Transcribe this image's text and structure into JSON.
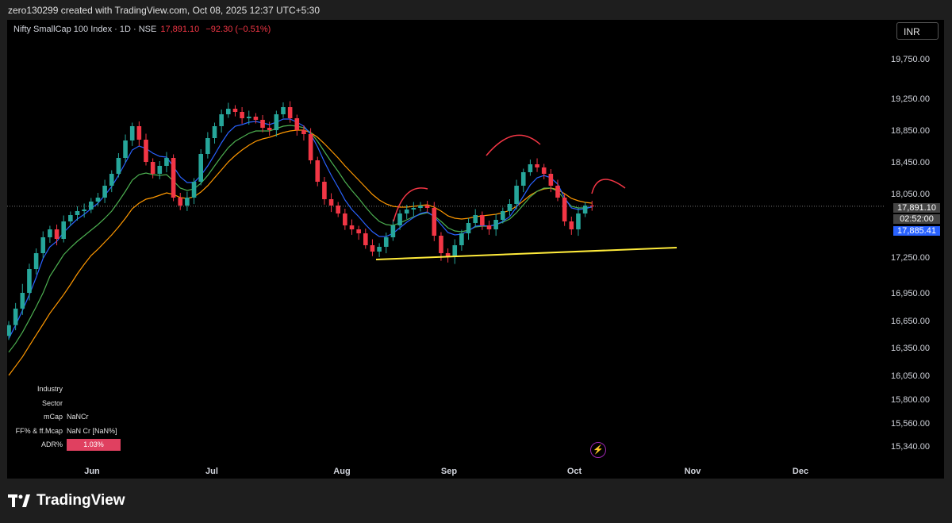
{
  "header": {
    "attribution": "zero130299 created with TradingView.com, Oct 08, 2025 12:37 UTC+5:30"
  },
  "symbol": {
    "name": "Nifty SmallCap 100 Index · 1D · NSE",
    "last": "17,891.10",
    "change": "−92.30 (−0.51%)"
  },
  "currency_button": "INR",
  "price_tags": {
    "last": "17,891.10",
    "countdown": "02:52:00",
    "ma": "17,885.41"
  },
  "info_table": {
    "industry_label": "Industry",
    "sector_label": "Sector",
    "mcap_label": "mCap",
    "mcap_value": "NaNCr",
    "ff_label": "FF% & ff.Mcap",
    "ff_value": "NaN Cr [NaN%]",
    "adr_label": "ADR%",
    "adr_value": "1.03%"
  },
  "footer": {
    "brand": "TradingView"
  },
  "icons": {
    "bolt": "lightning-icon",
    "logo": "tradingview-logo-icon"
  },
  "colors": {
    "up": "#26a69a",
    "down": "#f23645",
    "ma_fast": "#2962ff",
    "ma_mid": "#4caf50",
    "ma_slow": "#ff9800",
    "support": "#ffeb3b",
    "annotation": "#f23645"
  },
  "chart_data": {
    "type": "candlestick",
    "y_ticks": [
      "19,750.00",
      "19,250.00",
      "18,850.00",
      "18,450.00",
      "18,050.00",
      "17,250.00",
      "16,950.00",
      "16,650.00",
      "16,350.00",
      "16,050.00",
      "15,800.00",
      "15,560.00",
      "15,340.00"
    ],
    "x_ticks": [
      "Jun",
      "Jul",
      "Aug",
      "Sep",
      "Oct",
      "Nov",
      "Dec"
    ],
    "last_price": 17891.1,
    "closes": [
      16600,
      16780,
      16950,
      17150,
      17300,
      17500,
      17600,
      17480,
      17700,
      17780,
      17830,
      17850,
      17950,
      18000,
      18150,
      18300,
      18500,
      18720,
      18900,
      18730,
      18450,
      18300,
      18400,
      18500,
      18000,
      17900,
      18000,
      18200,
      18550,
      18750,
      18900,
      19050,
      19120,
      19080,
      19000,
      19020,
      18980,
      18880,
      18850,
      19050,
      19140,
      19000,
      18850,
      18800,
      18470,
      18200,
      17980,
      17900,
      17800,
      17650,
      17600,
      17550,
      17400,
      17320,
      17380,
      17500,
      17650,
      17800,
      17850,
      17870,
      17900,
      17870,
      17520,
      17300,
      17250,
      17400,
      17550,
      17680,
      17780,
      17650,
      17600,
      17720,
      17830,
      17920,
      18150,
      18320,
      18420,
      18380,
      18300,
      18150,
      18000,
      17700,
      17600,
      17800,
      17900,
      17891.1
    ],
    "ma_fast": [
      16450,
      16600,
      16760,
      16930,
      17080,
      17240,
      17380,
      17450,
      17560,
      17650,
      17730,
      17790,
      17860,
      17930,
      18030,
      18140,
      18280,
      18440,
      18600,
      18650,
      18620,
      18560,
      18520,
      18510,
      18390,
      18260,
      18190,
      18190,
      18280,
      18400,
      18540,
      18690,
      18820,
      18900,
      18920,
      18950,
      18960,
      18940,
      18920,
      18950,
      18990,
      18990,
      18950,
      18900,
      18800,
      18640,
      18450,
      18280,
      18130,
      17970,
      17850,
      17760,
      17660,
      17570,
      17510,
      17510,
      17550,
      17620,
      17690,
      17750,
      17800,
      17820,
      17760,
      17660,
      17560,
      17530,
      17540,
      17580,
      17640,
      17650,
      17640,
      17660,
      17700,
      17760,
      17880,
      18020,
      18160,
      18250,
      18280,
      18250,
      18170,
      18000,
      17870,
      17850,
      17860,
      17885.41
    ],
    "ma_mid": [
      16300,
      16400,
      16520,
      16660,
      16800,
      16950,
      17090,
      17180,
      17280,
      17370,
      17450,
      17520,
      17590,
      17660,
      17740,
      17830,
      17950,
      18080,
      18220,
      18290,
      18310,
      18290,
      18280,
      18290,
      18210,
      18120,
      18090,
      18110,
      18180,
      18280,
      18400,
      18520,
      18630,
      18710,
      18760,
      18810,
      18840,
      18840,
      18840,
      18870,
      18900,
      18910,
      18900,
      18880,
      18820,
      18710,
      18580,
      18450,
      18330,
      18200,
      18090,
      17990,
      17880,
      17780,
      17700,
      17660,
      17650,
      17680,
      17720,
      17760,
      17790,
      17810,
      17770,
      17700,
      17620,
      17580,
      17570,
      17590,
      17630,
      17640,
      17640,
      17660,
      17690,
      17730,
      17810,
      17910,
      18010,
      18080,
      18120,
      18120,
      18080,
      17980,
      17890,
      17870,
      17870,
      17880
    ],
    "ma_slow": [
      16050,
      16150,
      16250,
      16370,
      16490,
      16610,
      16730,
      16830,
      16930,
      17020,
      17110,
      17190,
      17270,
      17350,
      17440,
      17530,
      17630,
      17740,
      17860,
      17930,
      17980,
      18000,
      18030,
      18060,
      18040,
      18000,
      17990,
      18010,
      18070,
      18150,
      18250,
      18350,
      18450,
      18530,
      18600,
      18660,
      18710,
      18740,
      18760,
      18790,
      18820,
      18840,
      18850,
      18850,
      18820,
      18760,
      18680,
      18590,
      18500,
      18400,
      18310,
      18220,
      18130,
      18040,
      17970,
      17920,
      17890,
      17880,
      17880,
      17890,
      17900,
      17910,
      17880,
      17830,
      17770,
      17740,
      17730,
      17740,
      17760,
      17770,
      17780,
      17790,
      17810,
      17840,
      17890,
      17960,
      18030,
      18080,
      18110,
      18120,
      18100,
      18050,
      17990,
      17960,
      17940,
      17930
    ]
  }
}
